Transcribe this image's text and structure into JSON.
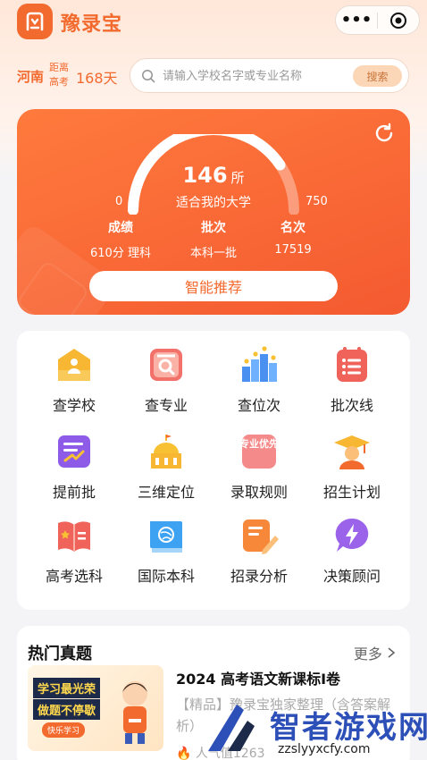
{
  "header": {
    "app_name": "豫录宝",
    "more_icon": "more-dots-icon",
    "close_icon": "target-circle-icon"
  },
  "context": {
    "province": "河南",
    "dist_label": "距离高考",
    "days": "168天"
  },
  "search": {
    "placeholder": "请输入学校名字或专业名称",
    "button": "搜索"
  },
  "card": {
    "count": "146",
    "unit": "所",
    "subtitle": "适合我的大学",
    "min": "0",
    "max": "750",
    "score_fraction": 0.81,
    "stats": [
      {
        "label": "成绩",
        "value": "610分 理科"
      },
      {
        "label": "批次",
        "value": "本科一批"
      },
      {
        "label": "名次",
        "value": "17519"
      }
    ],
    "button": "智能推荐"
  },
  "grid": [
    {
      "label": "查学校",
      "icon": "school-icon"
    },
    {
      "label": "查专业",
      "icon": "major-search-icon"
    },
    {
      "label": "查位次",
      "icon": "rank-chart-icon"
    },
    {
      "label": "批次线",
      "icon": "batch-list-icon"
    },
    {
      "label": "提前批",
      "icon": "early-batch-icon"
    },
    {
      "label": "三维定位",
      "icon": "locate-building-icon"
    },
    {
      "label": "录取规则",
      "icon": "admission-rule-icon"
    },
    {
      "label": "招生计划",
      "icon": "graduation-cap-icon"
    },
    {
      "label": "高考选科",
      "icon": "book-star-icon"
    },
    {
      "label": "国际本科",
      "icon": "globe-book-icon"
    },
    {
      "label": "招录分析",
      "icon": "analysis-pen-icon"
    },
    {
      "label": "决策顾问",
      "icon": "lightning-bubble-icon"
    }
  ],
  "grid_icons_text": {
    "major_priority": "专业优先"
  },
  "hot": {
    "title": "热门真题",
    "more": "更多",
    "article": {
      "thumb_line1": "学习最光荣",
      "thumb_line2": "做题不停歇",
      "thumb_line3": "快乐学习",
      "title": "2024 高考语文新课标Ⅰ卷",
      "desc": "【精品】豫录宝独家整理（含答案解析）",
      "hot_label": "人气值1263"
    }
  },
  "watermark": {
    "main": "智者游戏网",
    "sub": "zzslyyxcfy.com"
  }
}
